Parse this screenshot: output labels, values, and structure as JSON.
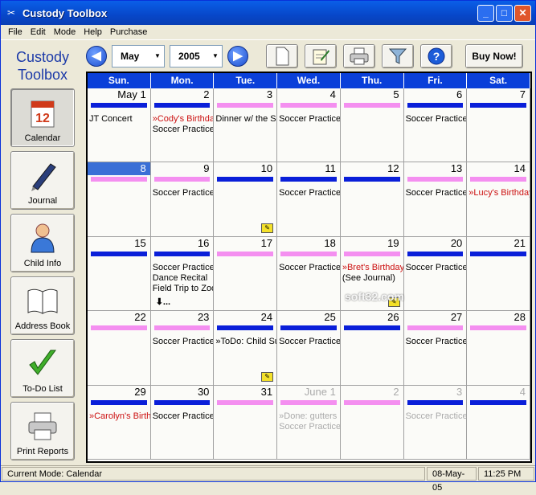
{
  "window": {
    "title": "Custody Toolbox"
  },
  "menu": [
    "File",
    "Edit",
    "Mode",
    "Help",
    "Purchase"
  ],
  "logo": {
    "line1": "Custody",
    "line2": "Toolbox"
  },
  "nav": [
    {
      "label": "Calendar",
      "icon": "calendar-icon",
      "active": true
    },
    {
      "label": "Journal",
      "icon": "pen-icon",
      "active": false
    },
    {
      "label": "Child Info",
      "icon": "person-icon",
      "active": false
    },
    {
      "label": "Address Book",
      "icon": "book-icon",
      "active": false
    },
    {
      "label": "To-Do List",
      "icon": "checkmark-icon",
      "active": false
    },
    {
      "label": "Print Reports",
      "icon": "printer-icon",
      "active": false
    }
  ],
  "toolbar": {
    "month": "May",
    "year": "2005",
    "buy_label": "Buy Now!"
  },
  "day_headers": [
    "Sun.",
    "Mon.",
    "Tue.",
    "Wed.",
    "Thu.",
    "Fri.",
    "Sat."
  ],
  "colors": {
    "blue_bar": "#0a1fd9",
    "pink_bar": "#f48ff0",
    "header": "#0a3fd9",
    "red_event": "#cc1111"
  },
  "weeks": [
    [
      {
        "num": "May 1",
        "bar": "blue",
        "events": [
          {
            "t": "JT Concert"
          }
        ]
      },
      {
        "num": "2",
        "bar": "blue",
        "events": [
          {
            "t": "»Cody's Birthday",
            "red": true
          },
          {
            "t": "Soccer Practice"
          }
        ]
      },
      {
        "num": "3",
        "bar": "pink",
        "events": [
          {
            "t": "Dinner w/ the Smiths"
          }
        ]
      },
      {
        "num": "4",
        "bar": "pink",
        "events": [
          {
            "t": "Soccer Practice"
          }
        ]
      },
      {
        "num": "5",
        "bar": "pink",
        "events": []
      },
      {
        "num": "6",
        "bar": "blue",
        "events": [
          {
            "t": "Soccer Practice"
          }
        ]
      },
      {
        "num": "7",
        "bar": "blue",
        "events": []
      }
    ],
    [
      {
        "num": "8",
        "bar": "pink",
        "events": [],
        "selected": true
      },
      {
        "num": "9",
        "bar": "pink",
        "events": [
          {
            "t": "Soccer Practice"
          }
        ]
      },
      {
        "num": "10",
        "bar": "blue",
        "events": [],
        "note": true
      },
      {
        "num": "11",
        "bar": "blue",
        "events": [
          {
            "t": "Soccer Practice"
          }
        ]
      },
      {
        "num": "12",
        "bar": "blue",
        "events": []
      },
      {
        "num": "13",
        "bar": "pink",
        "events": [
          {
            "t": "Soccer Practice"
          }
        ]
      },
      {
        "num": "14",
        "bar": "pink",
        "events": [
          {
            "t": "»Lucy's Birthday",
            "red": true
          }
        ]
      }
    ],
    [
      {
        "num": "15",
        "bar": "blue",
        "events": []
      },
      {
        "num": "16",
        "bar": "blue",
        "events": [
          {
            "t": "Soccer Practice"
          },
          {
            "t": "Dance Recital"
          },
          {
            "t": "Field Trip to Zoo"
          }
        ],
        "more": true
      },
      {
        "num": "17",
        "bar": "pink",
        "events": []
      },
      {
        "num": "18",
        "bar": "pink",
        "events": [
          {
            "t": "Soccer Practice"
          }
        ]
      },
      {
        "num": "19",
        "bar": "pink",
        "events": [
          {
            "t": "»Bret's Birthday",
            "red": true
          },
          {
            "t": "(See Journal)"
          }
        ],
        "note": true
      },
      {
        "num": "20",
        "bar": "blue",
        "events": [
          {
            "t": "Soccer Practice"
          }
        ]
      },
      {
        "num": "21",
        "bar": "blue",
        "events": []
      }
    ],
    [
      {
        "num": "22",
        "bar": "pink",
        "events": []
      },
      {
        "num": "23",
        "bar": "pink",
        "events": [
          {
            "t": "Soccer Practice"
          }
        ]
      },
      {
        "num": "24",
        "bar": "blue",
        "events": [
          {
            "t": "»ToDo: Child Support"
          }
        ],
        "note": true
      },
      {
        "num": "25",
        "bar": "blue",
        "events": [
          {
            "t": "Soccer Practice"
          }
        ]
      },
      {
        "num": "26",
        "bar": "blue",
        "events": []
      },
      {
        "num": "27",
        "bar": "pink",
        "events": [
          {
            "t": "Soccer Practice"
          }
        ]
      },
      {
        "num": "28",
        "bar": "pink",
        "events": []
      }
    ],
    [
      {
        "num": "29",
        "bar": "blue",
        "events": [
          {
            "t": "»Carolyn's Birthday",
            "red": true
          }
        ]
      },
      {
        "num": "30",
        "bar": "blue",
        "events": [
          {
            "t": "Soccer Practice"
          }
        ]
      },
      {
        "num": "31",
        "bar": "pink",
        "events": []
      },
      {
        "num": "June 1",
        "bar": "pink",
        "events": [
          {
            "t": "»Done: gutters"
          },
          {
            "t": "Soccer Practice"
          }
        ],
        "dim": true
      },
      {
        "num": "2",
        "bar": "pink",
        "events": [],
        "dim": true
      },
      {
        "num": "3",
        "bar": "blue",
        "events": [
          {
            "t": "Soccer Practice"
          }
        ],
        "dim": true
      },
      {
        "num": "4",
        "bar": "blue",
        "events": [],
        "dim": true
      }
    ]
  ],
  "status": {
    "mode": "Current Mode: Calendar",
    "date": "08-May-05",
    "time": "11:25 PM"
  },
  "watermark": "soft32.com"
}
